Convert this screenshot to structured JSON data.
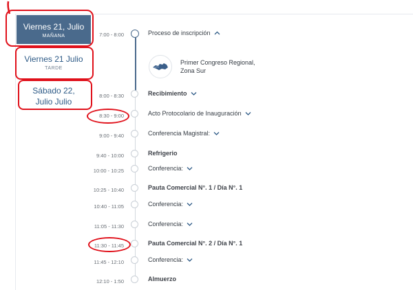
{
  "days": [
    {
      "title": "Viernes 21, Julio",
      "subtitle": "MAÑANA"
    },
    {
      "title": "Viernes 21 Julio",
      "subtitle": "TARDE"
    },
    {
      "title": "Sábado 22, Julio Julio",
      "subtitle": ""
    }
  ],
  "sessions": [
    {
      "time": "7:00 - 8:00",
      "label": "Proceso de inscripción"
    },
    {
      "time": "8:00 - 8:30",
      "label": "Recibimiento"
    },
    {
      "time": "8:30 - 9:00",
      "label": "Acto Protocolario de Inauguración"
    },
    {
      "time": "9:00 - 9:40",
      "label": "Conferencia Magistral:"
    },
    {
      "time": "9:40 - 10:00",
      "label": "Refrigerio"
    },
    {
      "time": "10:00 - 10:25",
      "label": "Conferencia:"
    },
    {
      "time": "10:25 - 10:40",
      "label": "Pauta Comercial N°. 1 / Día N°. 1"
    },
    {
      "time": "10:40 - 11:05",
      "label": "Conferencia:"
    },
    {
      "time": "11:05 - 11:30",
      "label": "Conferencia:"
    },
    {
      "time": "11:30 - 11:45",
      "label": "Pauta Comercial N°. 2 / Día N°. 1"
    },
    {
      "time": "11:45 - 12:10",
      "label": "Conferencia:"
    },
    {
      "time": "12:10 - 1:50",
      "label": "Almuerzo"
    }
  ],
  "event_card": {
    "name_line1": "Primer Congreso Regional,",
    "name_line2": "Zona Sur"
  },
  "colors": {
    "active_tab": "#4a6a8c",
    "accent": "#2d5a86",
    "annotation": "#e0101a"
  }
}
